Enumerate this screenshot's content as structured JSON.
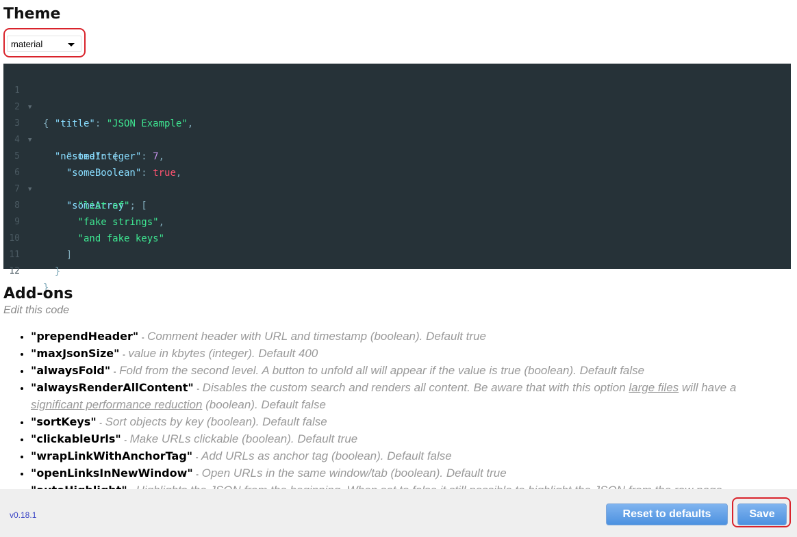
{
  "theme": {
    "title": "Theme",
    "selected": "material"
  },
  "editor": {
    "lines": [
      {
        "n": "1",
        "fold": true
      },
      {
        "n": "2",
        "fold": false
      },
      {
        "n": "3",
        "fold": true
      },
      {
        "n": "4",
        "fold": false
      },
      {
        "n": "5",
        "fold": false
      },
      {
        "n": "6",
        "fold": true
      },
      {
        "n": "7",
        "fold": false
      },
      {
        "n": "8",
        "fold": false
      },
      {
        "n": "9",
        "fold": false
      },
      {
        "n": "10",
        "fold": false
      },
      {
        "n": "11",
        "fold": false
      },
      {
        "n": "12",
        "fold": false
      }
    ],
    "tokens": {
      "l1": "{",
      "l2_key": "\"title\"",
      "l2_val": "\"JSON Example\"",
      "l3_key": "\"nested\"",
      "l3_open": "{",
      "l4_key": "\"someInteger\"",
      "l4_val": "7",
      "l5_key": "\"someBoolean\"",
      "l5_val": "true",
      "l6_key": "\"someArray\"",
      "l6_open": "[",
      "l7_val": "\"list of\"",
      "l8_val": "\"fake strings\"",
      "l9_val": "\"and fake keys\"",
      "l10": "]",
      "l11": "}",
      "l12": "}"
    }
  },
  "addons": {
    "title": "Add-ons",
    "subtitle": "Edit this code",
    "options": [
      {
        "name": "\"prependHeader\"",
        "desc": "Comment header with URL and timestamp (boolean). Default true"
      },
      {
        "name": "\"maxJsonSize\"",
        "desc": "value in kbytes (integer). Default 400"
      },
      {
        "name": "\"alwaysFold\"",
        "desc": "Fold from the second level. A button to unfold all will appear if the value is true (boolean). Default false"
      },
      {
        "name": "\"alwaysRenderAllContent\"",
        "desc_a": "Disables the custom search and renders all content. Be aware that with this option ",
        "link1": "large files",
        "desc_b": " will have a ",
        "link2": "significant performance reduction",
        "desc_c": " (boolean). Default false"
      },
      {
        "name": "\"sortKeys\"",
        "desc": "Sort objects by key (boolean). Default false"
      },
      {
        "name": "\"clickableUrls\"",
        "desc": "Make URLs clickable (boolean). Default true"
      },
      {
        "name": "\"wrapLinkWithAnchorTag\"",
        "desc": "Add URLs as anchor tag (boolean). Default false"
      },
      {
        "name": "\"openLinksInNewWindow\"",
        "desc": "Open URLs in the same window/tab (boolean). Default true"
      },
      {
        "name": "\"autoHighlight\"",
        "desc": "Highlights the JSON from the beginning. When set to false it still possible to highlight the JSON from the raw page"
      }
    ]
  },
  "footer": {
    "version": "v0.18.1",
    "reset_label": "Reset to defaults",
    "save_label": "Save"
  },
  "colors": {
    "editor_bg": "#263238",
    "accent_outline": "#d9232b",
    "button_blue": "#4c91e0"
  }
}
